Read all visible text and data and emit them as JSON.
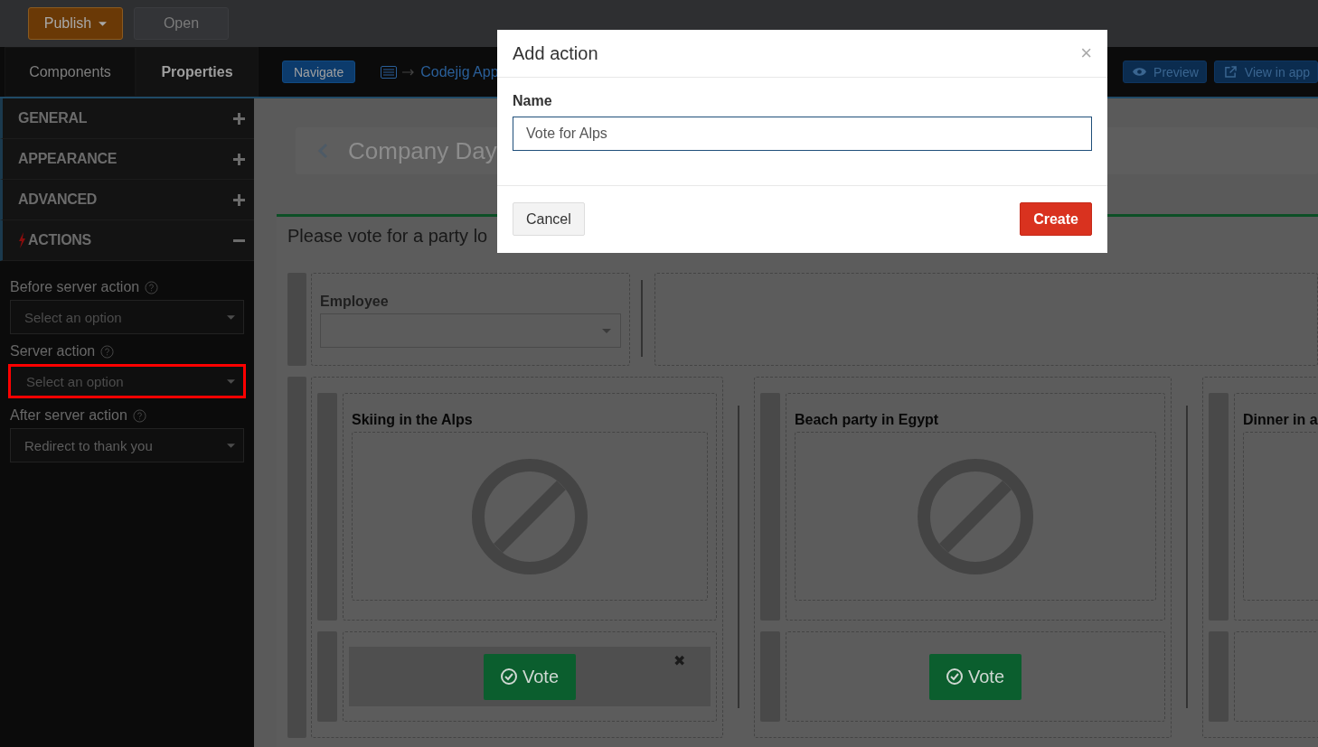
{
  "toolbar": {
    "buttons": [
      {
        "label": "Publish",
        "kind": "dropdown"
      },
      {
        "label": "Open",
        "kind": "plain"
      }
    ]
  },
  "panel_tabs": [
    {
      "label": "Components",
      "selected": false
    },
    {
      "label": "Properties",
      "selected": true
    }
  ],
  "navbar": {
    "navigate": "Navigate",
    "breadcrumb": "Codejig App",
    "actions": [
      {
        "label": "Preview",
        "kind": "eye"
      },
      {
        "label": "View in app",
        "kind": "external"
      }
    ]
  },
  "sections": [
    {
      "label": "GENERAL",
      "kind": "plain",
      "expanded": false
    },
    {
      "label": "APPEARANCE",
      "kind": "plain",
      "expanded": false
    },
    {
      "label": "ADVANCED",
      "kind": "plain",
      "expanded": false
    },
    {
      "label": "ACTIONS",
      "kind": "actions",
      "expanded": true
    }
  ],
  "fields": [
    {
      "label": "Before server action",
      "placeholder": "Select an option",
      "highlighted": false
    },
    {
      "label": "Server action",
      "placeholder": "Select an option",
      "highlighted": true
    },
    {
      "label": "After server action",
      "value": "Redirect to thank you",
      "highlighted": false
    }
  ],
  "page": {
    "title": "Company Day",
    "heading": "Please vote for a party lo",
    "employee_label": "Employee",
    "cards": [
      {
        "title": "Skiing in the Alps",
        "vote": "Vote",
        "remove": "✖"
      },
      {
        "title": "Beach party in Egypt",
        "vote": "Vote"
      },
      {
        "title": "Dinner in a"
      }
    ]
  },
  "dialog": {
    "title": "Add action",
    "close": "×",
    "name_label": "Name",
    "name_value": "Vote for Alps",
    "buttons": [
      {
        "label": "Cancel",
        "kind": "secondary"
      },
      {
        "label": "Create",
        "kind": "primary"
      }
    ]
  }
}
